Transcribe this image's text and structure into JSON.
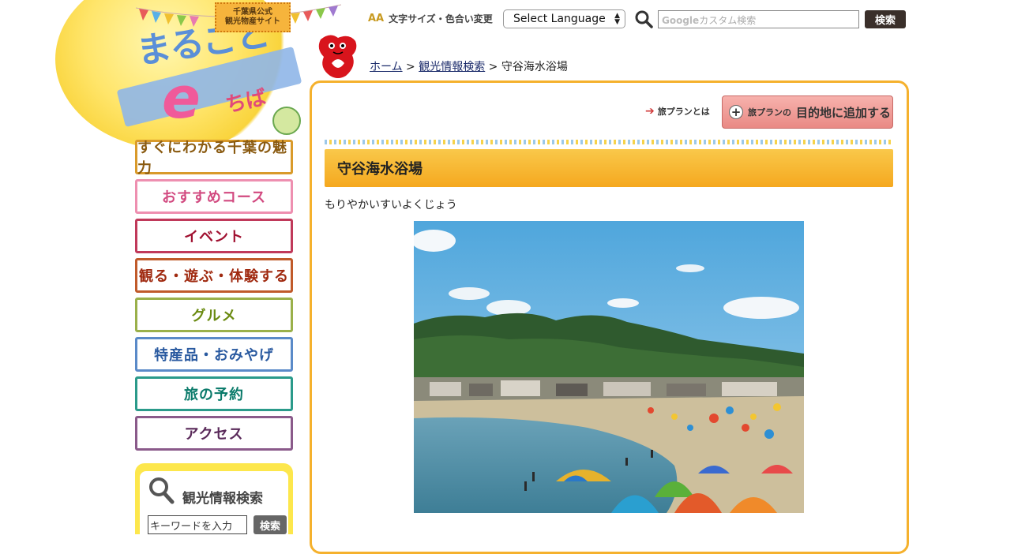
{
  "logo": {
    "badge_line1": "千葉県公式",
    "badge_line2": "観光物産サイト",
    "title_part1": "まるごと",
    "title_e": "e",
    "title_part2": "ちば"
  },
  "topbar": {
    "font_tool_icon": "AA",
    "font_tool_label": "文字サイズ・色合い変更",
    "language_select": "Select Language",
    "search_placeholder_brand": "Google",
    "search_placeholder": "カスタム検索",
    "search_button": "検索"
  },
  "breadcrumb": {
    "home": "ホーム",
    "sep1": " > ",
    "category": "観光情報検索",
    "sep2": " > ",
    "current": "守谷海水浴場"
  },
  "nav": {
    "items": [
      {
        "label": "すぐにわかる千葉の魅力",
        "color": "#d99a2a",
        "text": "#8a5a10"
      },
      {
        "label": "おすすめコース",
        "color": "#ee8fb0",
        "text": "#d24a80"
      },
      {
        "label": "イベント",
        "color": "#c0395a",
        "text": "#a01030"
      },
      {
        "label": "観る・遊ぶ・体験する",
        "color": "#c05a2a",
        "text": "#a02a10"
      },
      {
        "label": "グルメ",
        "color": "#9ab04a",
        "text": "#6a8a10"
      },
      {
        "label": "特産品・おみやげ",
        "color": "#5a8ac8",
        "text": "#2a5aa0"
      },
      {
        "label": "旅の予約",
        "color": "#2a9a8a",
        "text": "#0a7a6a"
      },
      {
        "label": "アクセス",
        "color": "#8a5a8a",
        "text": "#5a2a5a"
      }
    ]
  },
  "sidebar_search": {
    "title": "観光情報検索",
    "input_placeholder": "キーワードを入力",
    "button": "検索"
  },
  "main": {
    "plan_about": "旅プランとは",
    "plan_button_prefix": "旅プランの",
    "plan_button_main": "目的地に追加する",
    "title": "守谷海水浴場",
    "reading": "もりやかいすいよくじょう"
  },
  "colors": {
    "accent_orange": "#f5b12d",
    "title_bar": "#f5a81f",
    "plan_button": "#e98a85"
  }
}
